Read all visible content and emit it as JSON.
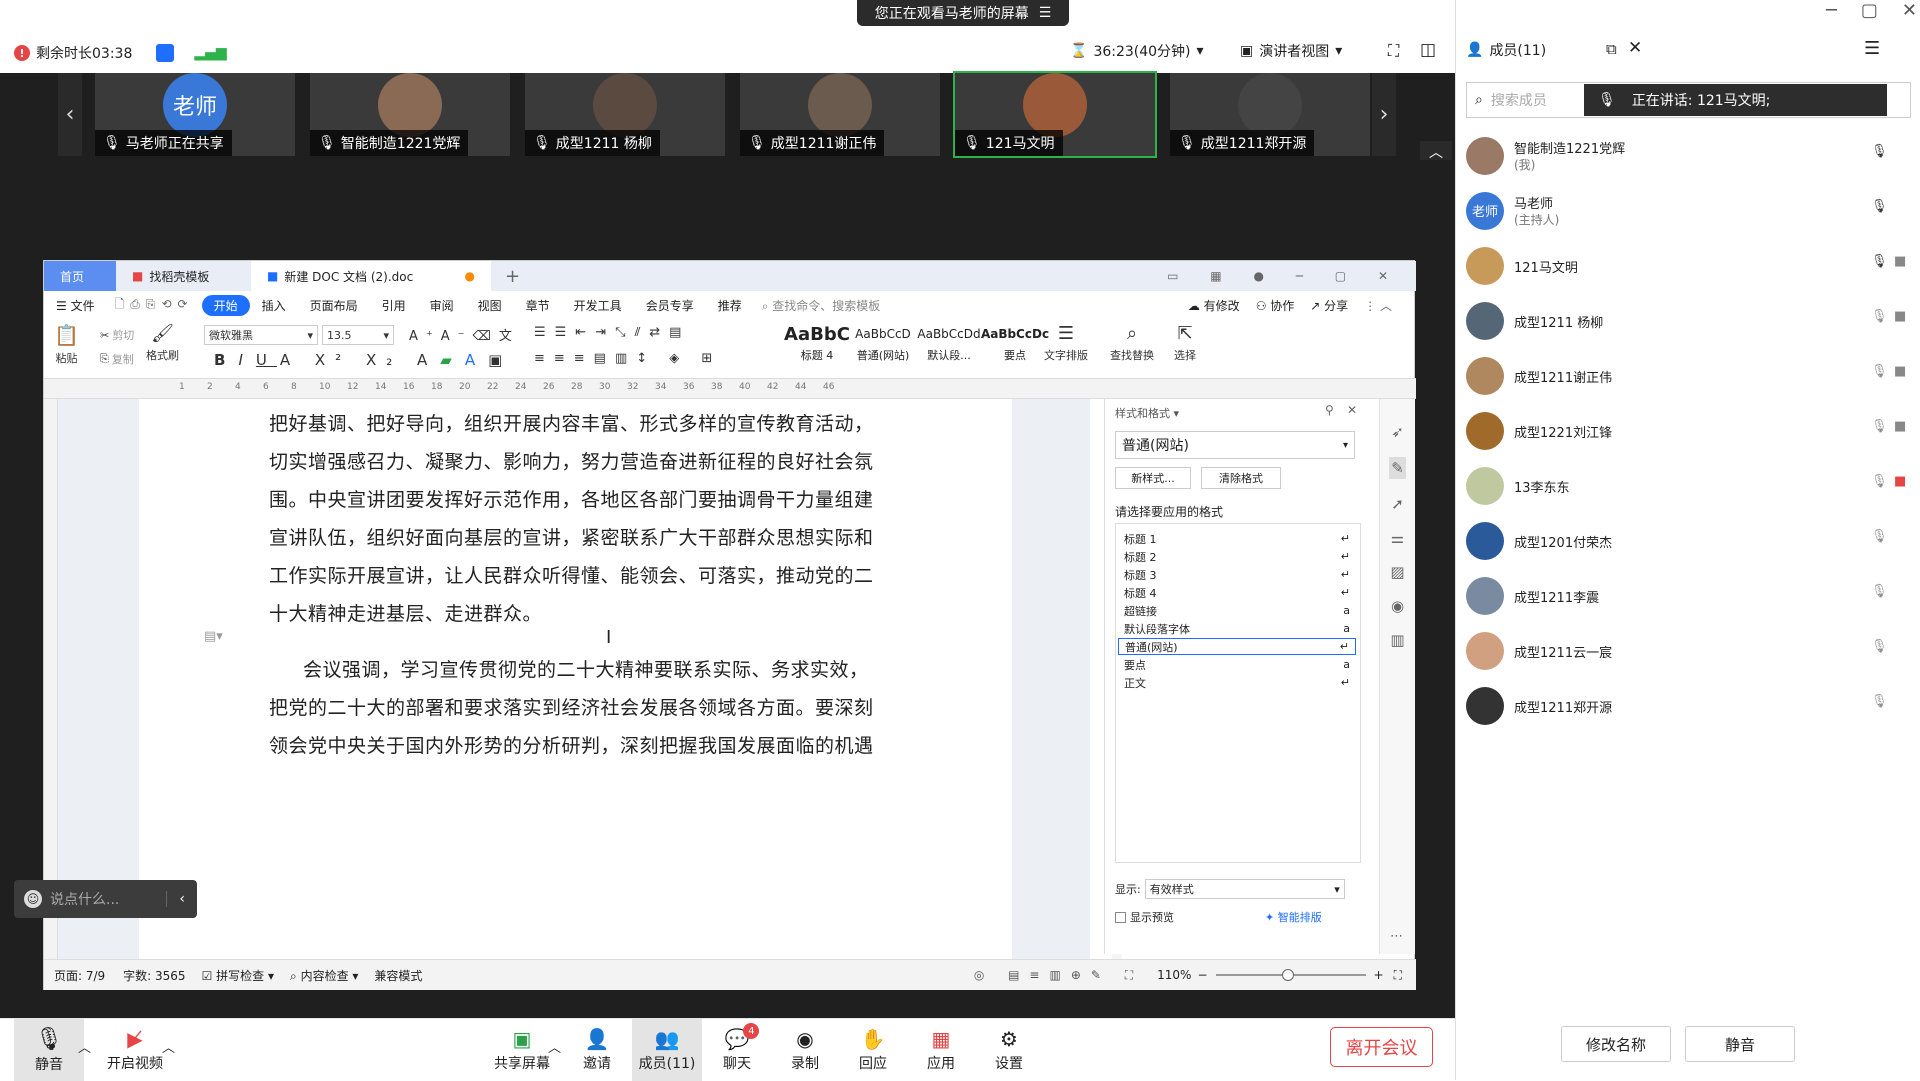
{
  "banner": {
    "text": "您正在观看马老师的屏幕"
  },
  "top": {
    "remaining": "剩余时长03:38",
    "timer": "36:23(40分钟)",
    "view": "演讲者视图"
  },
  "strip": {
    "tiles": [
      {
        "name": "马老师正在共享",
        "avatar": "老师",
        "color": "#3a78d8"
      },
      {
        "name": "智能制造1221党辉",
        "color": "#8a6a55"
      },
      {
        "name": "成型1211 杨柳",
        "color": "#5a4a40"
      },
      {
        "name": "成型1211谢正伟",
        "color": "#6b5a4e"
      },
      {
        "name": "121马文明",
        "color": "#9a5a3a"
      },
      {
        "name": "成型1211郑开源",
        "color": "#444444"
      }
    ]
  },
  "wps": {
    "tabs": [
      "首页",
      "找稻壳模板",
      "新建 DOC 文档 (2).doc"
    ],
    "menu": [
      "文件",
      "开始",
      "插入",
      "页面布局",
      "引用",
      "审阅",
      "视图",
      "章节",
      "开发工具",
      "会员专享",
      "推荐"
    ],
    "search": "查找命令、搜索模板",
    "right_menu": [
      "有修改",
      "协作",
      "分享"
    ],
    "ribbon": {
      "paste": "粘贴",
      "cut": "剪切",
      "copy": "复制",
      "format_painter": "格式刷",
      "font": "微软雅黑",
      "size": "13.5",
      "text_layout": "文字排版",
      "find_replace": "查找替换",
      "select": "选择"
    },
    "styles": [
      {
        "sample": "AaBbC",
        "name": "标题 4"
      },
      {
        "sample": "AaBbCcD",
        "name": "普通(网站)"
      },
      {
        "sample": "AaBbCcDd",
        "name": "默认段..."
      },
      {
        "sample": "AaBbCcDc",
        "name": "要点"
      }
    ],
    "ruler_ticks": [
      "1",
      "2",
      "4",
      "6",
      "8",
      "10",
      "12",
      "14",
      "16",
      "18",
      "20",
      "22",
      "24",
      "26",
      "28",
      "30",
      "32",
      "34",
      "36",
      "38",
      "40",
      "42",
      "44",
      "46"
    ],
    "doc_lines": [
      "把好基调、把好导向，组织开展内容丰富、形式多样的宣传教育活动，",
      "切实增强感召力、凝聚力、影响力，努力营造奋进新征程的良好社会氛",
      "围。中央宣讲团要发挥好示范作用，各地区各部门要抽调骨干力量组建",
      "宣讲队伍，组织好面向基层的宣讲，紧密联系广大干部群众思想实际和",
      "工作实际开展宣讲，让人民群众听得懂、能领会、可落实，推动党的二",
      "十大精神走进基层、走进群众。",
      "会议强调，学习宣传贯彻党的二十大精神要联系实际、务求实效，",
      "把党的二十大的部署和要求落实到经济社会发展各领域各方面。要深刻",
      "领会党中央关于国内外形势的分析研判，深刻把握我国发展面临的机遇"
    ],
    "stylepane": {
      "title": "样式和格式",
      "current": "普通(网站)",
      "new_style": "新样式...",
      "clear": "清除格式",
      "prompt": "请选择要应用的格式",
      "items": [
        "标题 1",
        "标题 2",
        "标题 3",
        "标题 4",
        "超链接",
        "默认段落字体",
        "普通(网站)",
        "要点",
        "正文"
      ],
      "show_label": "显示:",
      "show_value": "有效样式",
      "preview": "显示预览",
      "smart": "智能排版"
    },
    "status": {
      "page": "页面: 7/9",
      "words": "字数: 3565",
      "spell": "拼写检查",
      "content": "内容检查",
      "compat": "兼容模式",
      "zoom": "110%"
    }
  },
  "chat": {
    "placeholder": "说点什么..."
  },
  "bottom": {
    "buttons": [
      "静音",
      "开启视频",
      "共享屏幕",
      "邀请",
      "成员(11)",
      "聊天",
      "录制",
      "回应",
      "应用",
      "设置"
    ],
    "chat_badge": "4",
    "leave": "离开会议"
  },
  "panel": {
    "title": "成员(11)",
    "search_placeholder": "搜索成员",
    "speaking": "正在讲话:  121马文明;",
    "members": [
      {
        "name": "智能制造1221党辉",
        "sub": "(我)",
        "color": "#9a7a66"
      },
      {
        "name": "马老师",
        "sub": "(主持人)",
        "color": "#3a78d8",
        "avatar": "老师"
      },
      {
        "name": "121马文明",
        "sub": "",
        "color": "#c89a5a"
      },
      {
        "name": "成型1211 杨柳",
        "sub": "",
        "color": "#556677"
      },
      {
        "name": "成型1211谢正伟",
        "sub": "",
        "color": "#b08860"
      },
      {
        "name": "成型1221刘江锋",
        "sub": "",
        "color": "#a06a2a"
      },
      {
        "name": "13李东东",
        "sub": "",
        "color": "#c0c8a0"
      },
      {
        "name": "成型1201付荣杰",
        "sub": "",
        "color": "#2a5a9a"
      },
      {
        "name": "成型1211李震",
        "sub": "",
        "color": "#7a8aa0"
      },
      {
        "name": "成型1211云一宸",
        "sub": "",
        "color": "#d0a080"
      },
      {
        "name": "成型1211郑开源",
        "sub": "",
        "color": "#333333"
      }
    ],
    "rename": "修改名称",
    "mute": "静音"
  }
}
